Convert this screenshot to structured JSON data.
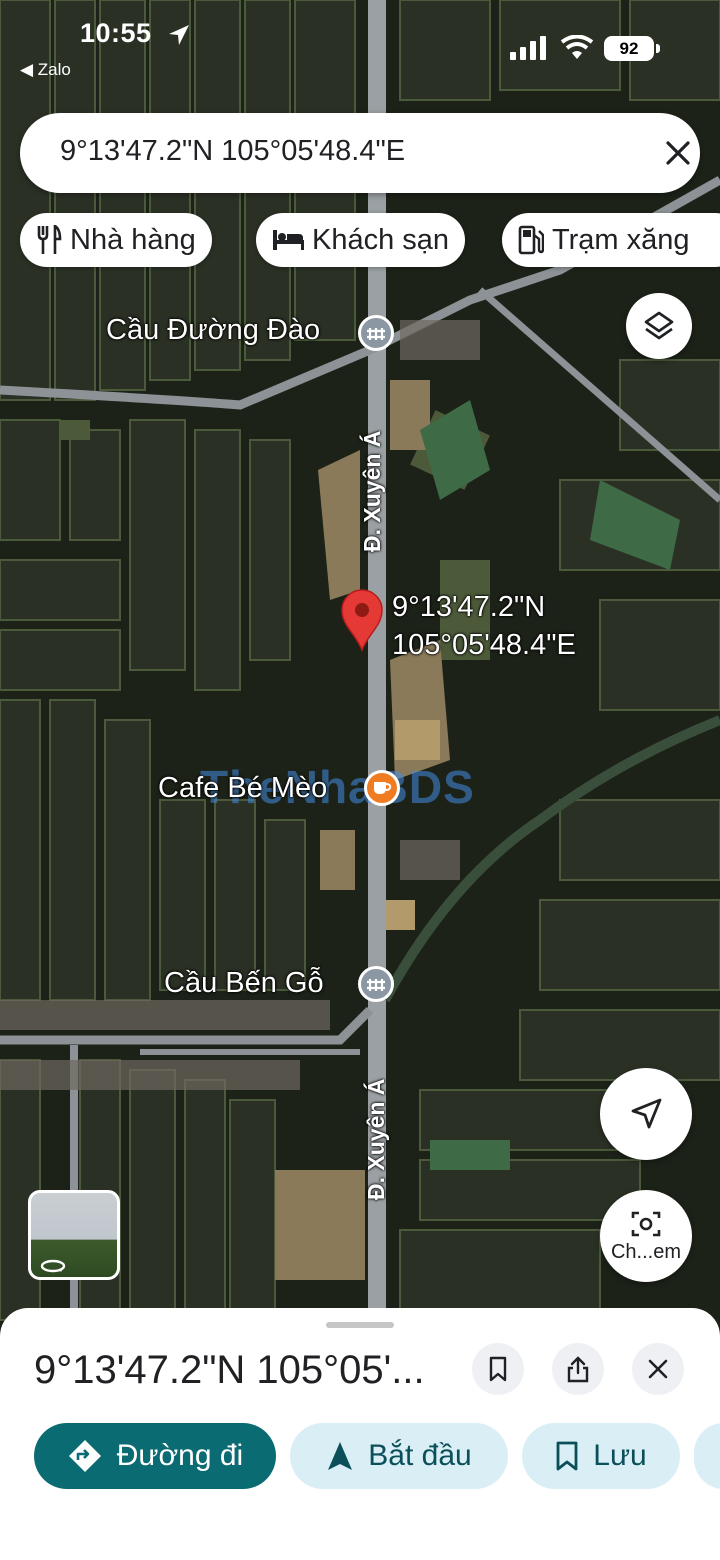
{
  "status_bar": {
    "time": "10:55",
    "back_app": "Zalo",
    "battery": "92"
  },
  "search": {
    "query": "9°13'47.2\"N 105°05'48.4\"E"
  },
  "chips": [
    {
      "label": "Nhà hàng",
      "icon": "restaurant-icon"
    },
    {
      "label": "Khách sạn",
      "icon": "hotel-icon"
    },
    {
      "label": "Trạm xăng",
      "icon": "gas-station-icon"
    }
  ],
  "map": {
    "places": {
      "bridge_1": "Cầu Đường Đào",
      "cafe": "Cafe Bé Mèo",
      "bridge_2": "Cầu Bến Gỗ"
    },
    "roads": {
      "upper": "Đ. Xuyên Á",
      "lower": "Đ. Xuyên Á"
    },
    "pin": {
      "lat": "9°13'47.2\"N",
      "lng": "105°05'48.4\"E"
    },
    "watermark": "TheNhaBDS",
    "lens_label": "Ch...em"
  },
  "sheet": {
    "title": "9°13'47.2\"N 105°05'...",
    "actions": [
      {
        "label": "Đường đi",
        "icon": "directions-icon"
      },
      {
        "label": "Bắt đầu",
        "icon": "navigate-icon"
      },
      {
        "label": "Lưu",
        "icon": "bookmark-icon"
      }
    ]
  },
  "colors": {
    "primary": "#0b6b72",
    "pale_button": "#d9eef5",
    "pin_red": "#e53935",
    "cafe_orange": "#f07c22",
    "bridge_gray": "#8b98a3"
  }
}
